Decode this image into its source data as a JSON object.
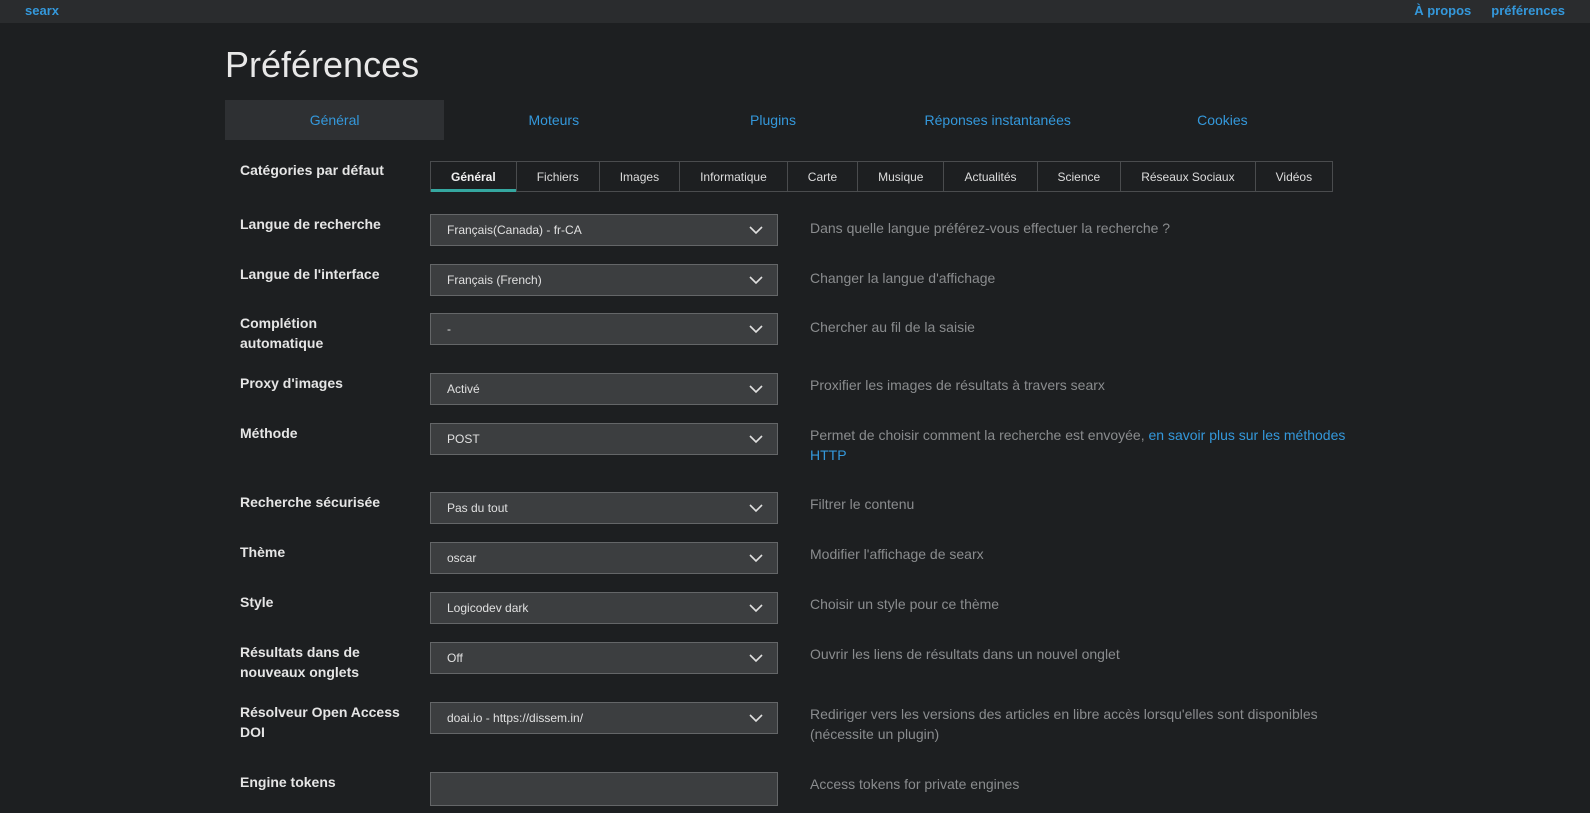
{
  "topbar": {
    "brand": "searx",
    "links": [
      "À propos",
      "préférences"
    ]
  },
  "page": {
    "title": "Préférences"
  },
  "main_tabs": [
    "Général",
    "Moteurs",
    "Plugins",
    "Réponses instantanées",
    "Cookies"
  ],
  "categories": {
    "label": "Catégories par défaut",
    "items": [
      "Général",
      "Fichiers",
      "Images",
      "Informatique",
      "Carte",
      "Musique",
      "Actualités",
      "Science",
      "Réseaux Sociaux",
      "Vidéos"
    ],
    "selected": "Général"
  },
  "settings": [
    {
      "label": "Langue de recherche",
      "value": "Français(Canada) - fr-CA",
      "help": "Dans quelle langue préférez-vous effectuer la recherche ?"
    },
    {
      "label": "Langue de l'interface",
      "value": "Français (French)",
      "help": "Changer la langue d'affichage"
    },
    {
      "label": "Complétion automatique",
      "value": "-",
      "help": "Chercher au fil de la saisie"
    },
    {
      "label": "Proxy d'images",
      "value": "Activé",
      "help": "Proxifier les images de résultats à travers searx"
    },
    {
      "label": "Méthode",
      "value": "POST",
      "help": "Permet de choisir comment la recherche est envoyée,",
      "help_link": "en savoir plus sur les méthodes HTTP"
    },
    {
      "label": "Recherche sécurisée",
      "value": "Pas du tout",
      "help": "Filtrer le contenu"
    },
    {
      "label": "Thème",
      "value": "oscar",
      "help": "Modifier l'affichage de searx"
    },
    {
      "label": "Style",
      "value": "Logicodev dark",
      "help": "Choisir un style pour ce thème"
    },
    {
      "label": "Résultats dans de nouveaux onglets",
      "value": "Off",
      "help": "Ouvrir les liens de résultats dans un nouvel onglet"
    },
    {
      "label": "Résolveur Open Access DOI",
      "value": "doai.io - https://dissem.in/",
      "help": "Rediriger vers les versions des articles en libre accès lorsqu'elles sont disponibles (nécessite un plugin)"
    },
    {
      "label": "Engine tokens",
      "value": "",
      "help": "Access tokens for private engines"
    }
  ],
  "icons": {
    "dropdown": "chevron-down-icon"
  },
  "colors": {
    "accent": "#3498db",
    "active_tab_underline": "#35a7a0",
    "background": "#1d1f21"
  }
}
